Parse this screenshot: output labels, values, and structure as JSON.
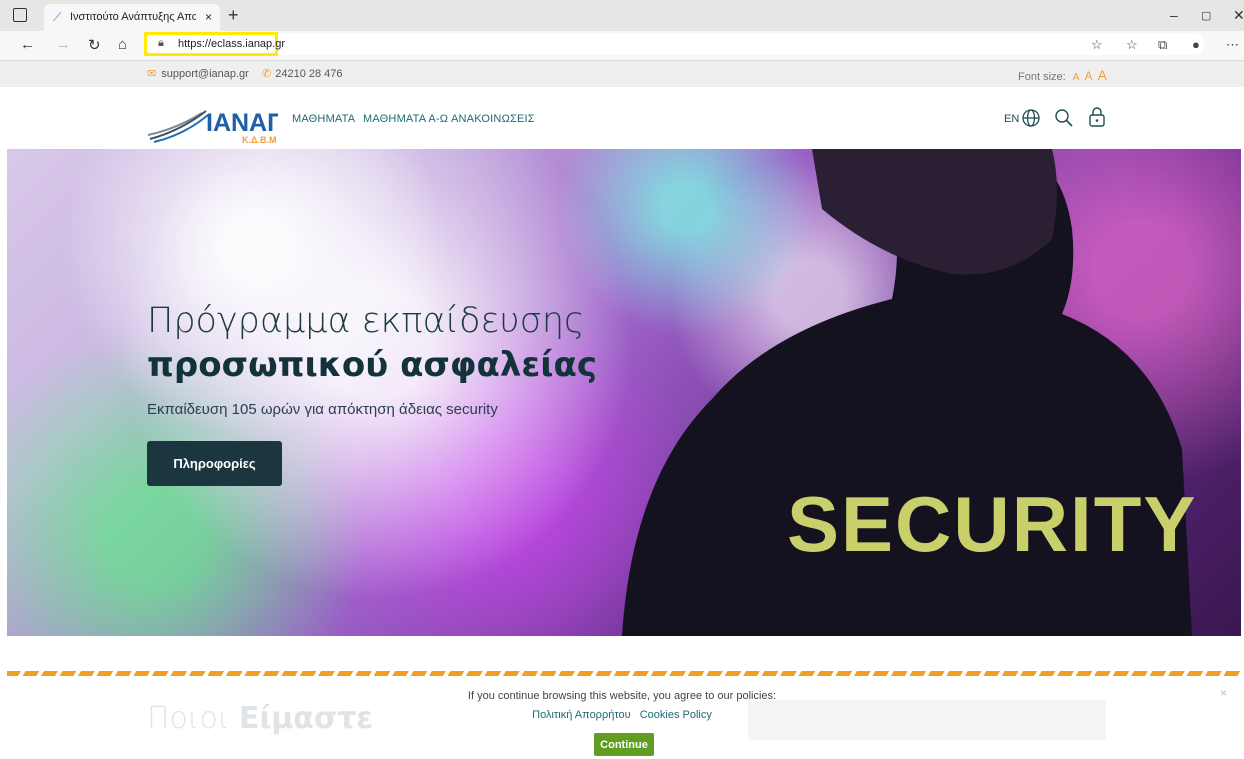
{
  "browser": {
    "tab_title": "Ινστιτούτο Ανάπτυξης Απασχόλ",
    "tab_close": "×",
    "new_tab": "+",
    "url": "https://eclass.ianap.gr",
    "window_controls": [
      "–",
      "▢",
      "✕"
    ]
  },
  "topbar": {
    "email": "support@ianap.gr",
    "phone": "24210 28 476",
    "font_size_label": "Font size:",
    "font_size_options": [
      "A",
      "A",
      "A"
    ]
  },
  "header": {
    "logo_text": "ΙΑΝΑΠ",
    "logo_sub": "Κ.Δ.Β.Μ",
    "nav": [
      "ΜΑΘΗΜΑΤΑ",
      "ΜΑΘΗΜΑΤΑ Α-Ω",
      "ΑΝΑΚΟΙΝΩΣΕΙΣ"
    ],
    "language": "EN"
  },
  "hero": {
    "title_line1": "Πρόγραμμα εκπαίδευσης",
    "title_line2": "προσωπικού ασφαλείας",
    "subtitle": "Εκπαίδευση 105 ωρών για απόκτηση άδειας security",
    "button_label": "Πληροφορίες",
    "jacket_text": "SECURITY"
  },
  "section": {
    "title_light": "Ποιοι",
    "title_bold": "Είμαστε"
  },
  "cookie": {
    "message": "If you continue browsing this website, you agree to our policies:",
    "privacy_link": "Πολιτική Απορρήτου",
    "cookies_link": "Cookies Policy",
    "continue_label": "Continue",
    "close": "×"
  },
  "colors": {
    "accent_orange": "#f0a030",
    "primary_dark": "#1c3640",
    "nav_teal": "#1e6a74",
    "continue_green": "#5f9e20",
    "url_highlight": "#ffeb00"
  }
}
